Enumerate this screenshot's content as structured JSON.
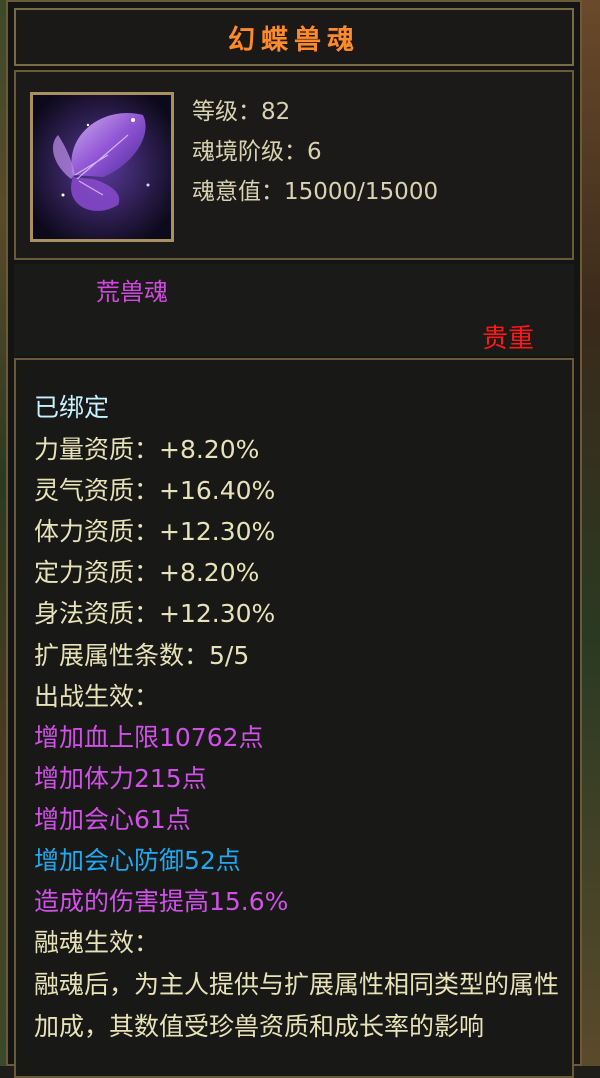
{
  "title": "幻蝶兽魂",
  "stats": {
    "level": "等级：82",
    "realm": "魂境阶级：6",
    "soul_value": "魂意值：15000/15000"
  },
  "category": "荒兽魂",
  "rarity": "贵重",
  "details": {
    "bound": "已绑定",
    "aptitudes": [
      "力量资质：+8.20%",
      "灵气资质：+16.40%",
      "体力资质：+12.30%",
      "定力资质：+8.20%",
      "身法资质：+12.30%"
    ],
    "ext_count": "扩展属性条数：5/5",
    "battle_header": "出战生效：",
    "battle_effects": [
      "增加血上限10762点",
      "增加体力215点",
      "增加会心61点"
    ],
    "battle_effect_blue": "增加会心防御52点",
    "battle_effect_last": "造成的伤害提高15.6%",
    "fusion_header": "融魂生效：",
    "fusion_desc": "融魂后，为主人提供与扩展属性相同类型的属性加成，其数值受珍兽资质和成长率的影响"
  },
  "colors": {
    "title": "#ff8a2a",
    "rarity": "#ff1818",
    "magenta": "#d050e8",
    "blue": "#20a8f0"
  },
  "icon": "butterfly-spirit-icon"
}
